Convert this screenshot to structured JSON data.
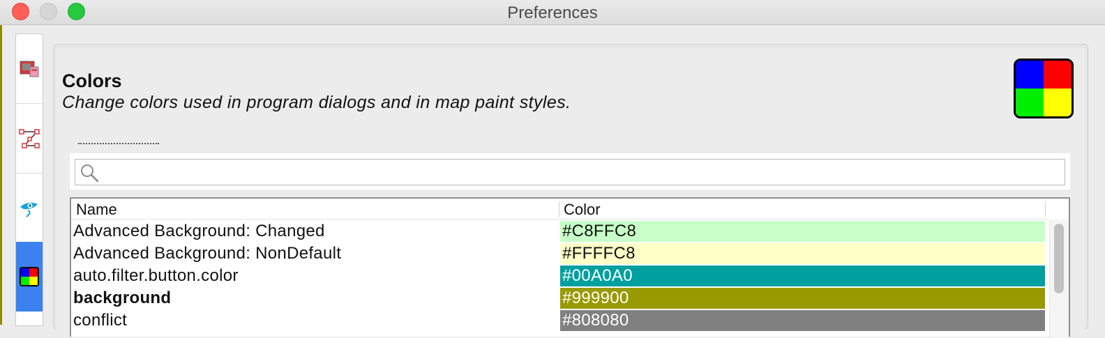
{
  "window": {
    "title": "Preferences"
  },
  "sidebar": {
    "items": [
      {
        "icon": "display-settings-icon",
        "active": false
      },
      {
        "icon": "draw-node-icon",
        "active": false
      },
      {
        "icon": "remote-control-icon",
        "active": false
      },
      {
        "icon": "colors-icon",
        "active": true
      }
    ]
  },
  "page": {
    "heading": "Colors",
    "description": "Change colors used in program dialogs and in map paint styles.",
    "icon": "colors-icon"
  },
  "search": {
    "value": "",
    "placeholder": ""
  },
  "table": {
    "headers": {
      "name": "Name",
      "color": "Color"
    },
    "rows": [
      {
        "name": "Advanced Background: Changed",
        "bold": false,
        "color": "#C8FFC8",
        "text_color": "#111111"
      },
      {
        "name": "Advanced Background: NonDefault",
        "bold": false,
        "color": "#FFFFC8",
        "text_color": "#111111"
      },
      {
        "name": "auto.filter.button.color",
        "bold": false,
        "color": "#00A0A0",
        "text_color": "#ffffff"
      },
      {
        "name": "background",
        "bold": true,
        "color": "#999900",
        "text_color": "#ffffff"
      },
      {
        "name": "conflict",
        "bold": false,
        "color": "#808080",
        "text_color": "#ffffff"
      }
    ]
  }
}
